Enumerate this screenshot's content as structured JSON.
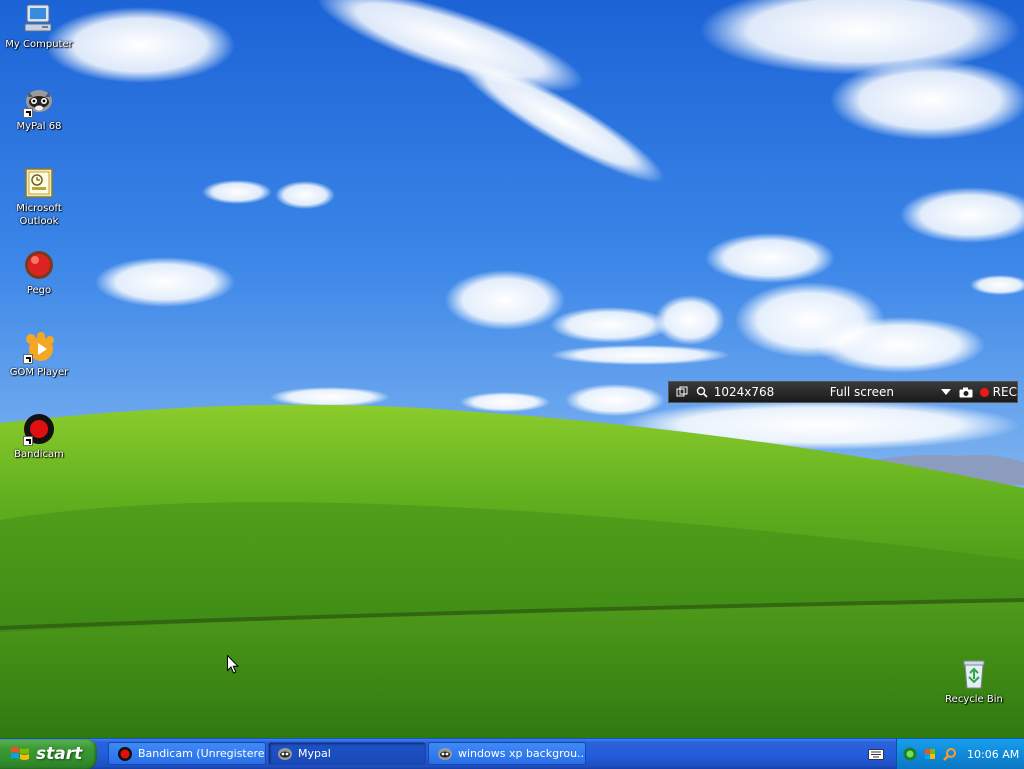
{
  "desktop": {
    "icons": [
      {
        "label": "My Computer",
        "icon": "my-computer-icon"
      },
      {
        "label": "MyPal 68",
        "icon": "mypal-icon"
      },
      {
        "label": "Microsoft Outlook",
        "icon": "outlook-icon"
      },
      {
        "label": "Pego",
        "icon": "pego-icon"
      },
      {
        "label": "GOM Player",
        "icon": "gom-player-icon"
      },
      {
        "label": "Bandicam",
        "icon": "bandicam-icon"
      }
    ],
    "recycle_bin": {
      "label": "Recycle Bin",
      "icon": "recycle-bin-icon"
    }
  },
  "bandicam_bar": {
    "resolution": "1024x768",
    "mode": "Full screen",
    "rec_label": "REC"
  },
  "taskbar": {
    "start_label": "start",
    "buttons": [
      {
        "label": "Bandicam (Unregistere...",
        "icon": "bandicam-icon"
      },
      {
        "label": "Mypal",
        "icon": "mypal-icon"
      },
      {
        "label": "windows xp backgrou...",
        "icon": "mypal-icon"
      }
    ],
    "clock": "10:06 AM"
  },
  "colors": {
    "taskbar_blue": "#245edb",
    "start_green": "#3c9a38",
    "tray_blue": "#0f8ad8",
    "rec_red": "#e81b1b"
  }
}
